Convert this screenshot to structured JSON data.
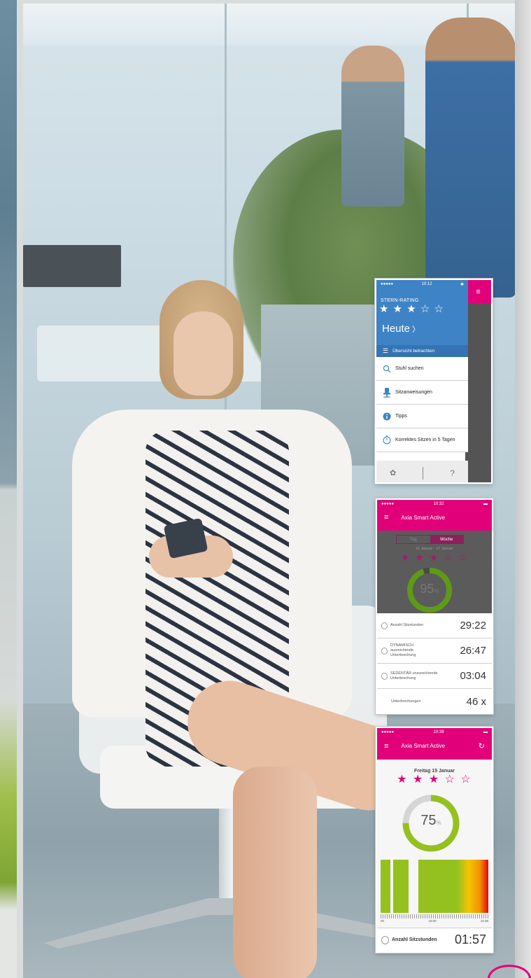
{
  "colors": {
    "accent": "#e2007a",
    "blue": "#3e83c6",
    "green": "#95c11f"
  },
  "screen_menu": {
    "status_dots": "●●●●●",
    "status_time": "10:12",
    "rating_label": "STERN-RATING",
    "stars": "★ ★ ★ ☆ ☆",
    "today": "Heute",
    "today_chevron": "〉",
    "overview": "Übersicht betrachten",
    "items": [
      {
        "icon": "search-icon",
        "label": "Stuhl suchen"
      },
      {
        "icon": "chair-icon",
        "label": "Sitzanweisungen"
      },
      {
        "icon": "info-icon",
        "label": "Tipps"
      },
      {
        "icon": "timer-icon",
        "label": "Korrektes Sitzen in 5 Tagen"
      }
    ],
    "footer_help": "?"
  },
  "screen_week": {
    "status_time": "10:32",
    "title": "Axia Smart Active",
    "segments": [
      "Tag",
      "Woche"
    ],
    "range": "11 Januar - 17 Januar",
    "stars": "★ ★ ★ ☆ ☆",
    "percent": 95,
    "percent_unit": "%",
    "rows": [
      {
        "label": "Anzahl Sitzstunden",
        "value": "29:22"
      },
      {
        "label": "DYNAMISCH ausreichende Unterbrechung",
        "value": "26:47"
      },
      {
        "label": "SEDENTÄR unzureichende Unterbrechung",
        "value": "03:04"
      },
      {
        "label": "Unterbrechungen",
        "value": "46 x"
      }
    ]
  },
  "screen_day": {
    "status_time": "10:38",
    "title": "Axia Smart Active",
    "date": "Freitag 15 Januar",
    "stars": "★ ★ ★ ☆ ☆",
    "percent": 75,
    "percent_unit": "%",
    "ticks": [
      "00",
      "10:00",
      "10:38"
    ],
    "footer_label": "Anzahl Sitzstunden",
    "footer_value": "01:57"
  }
}
